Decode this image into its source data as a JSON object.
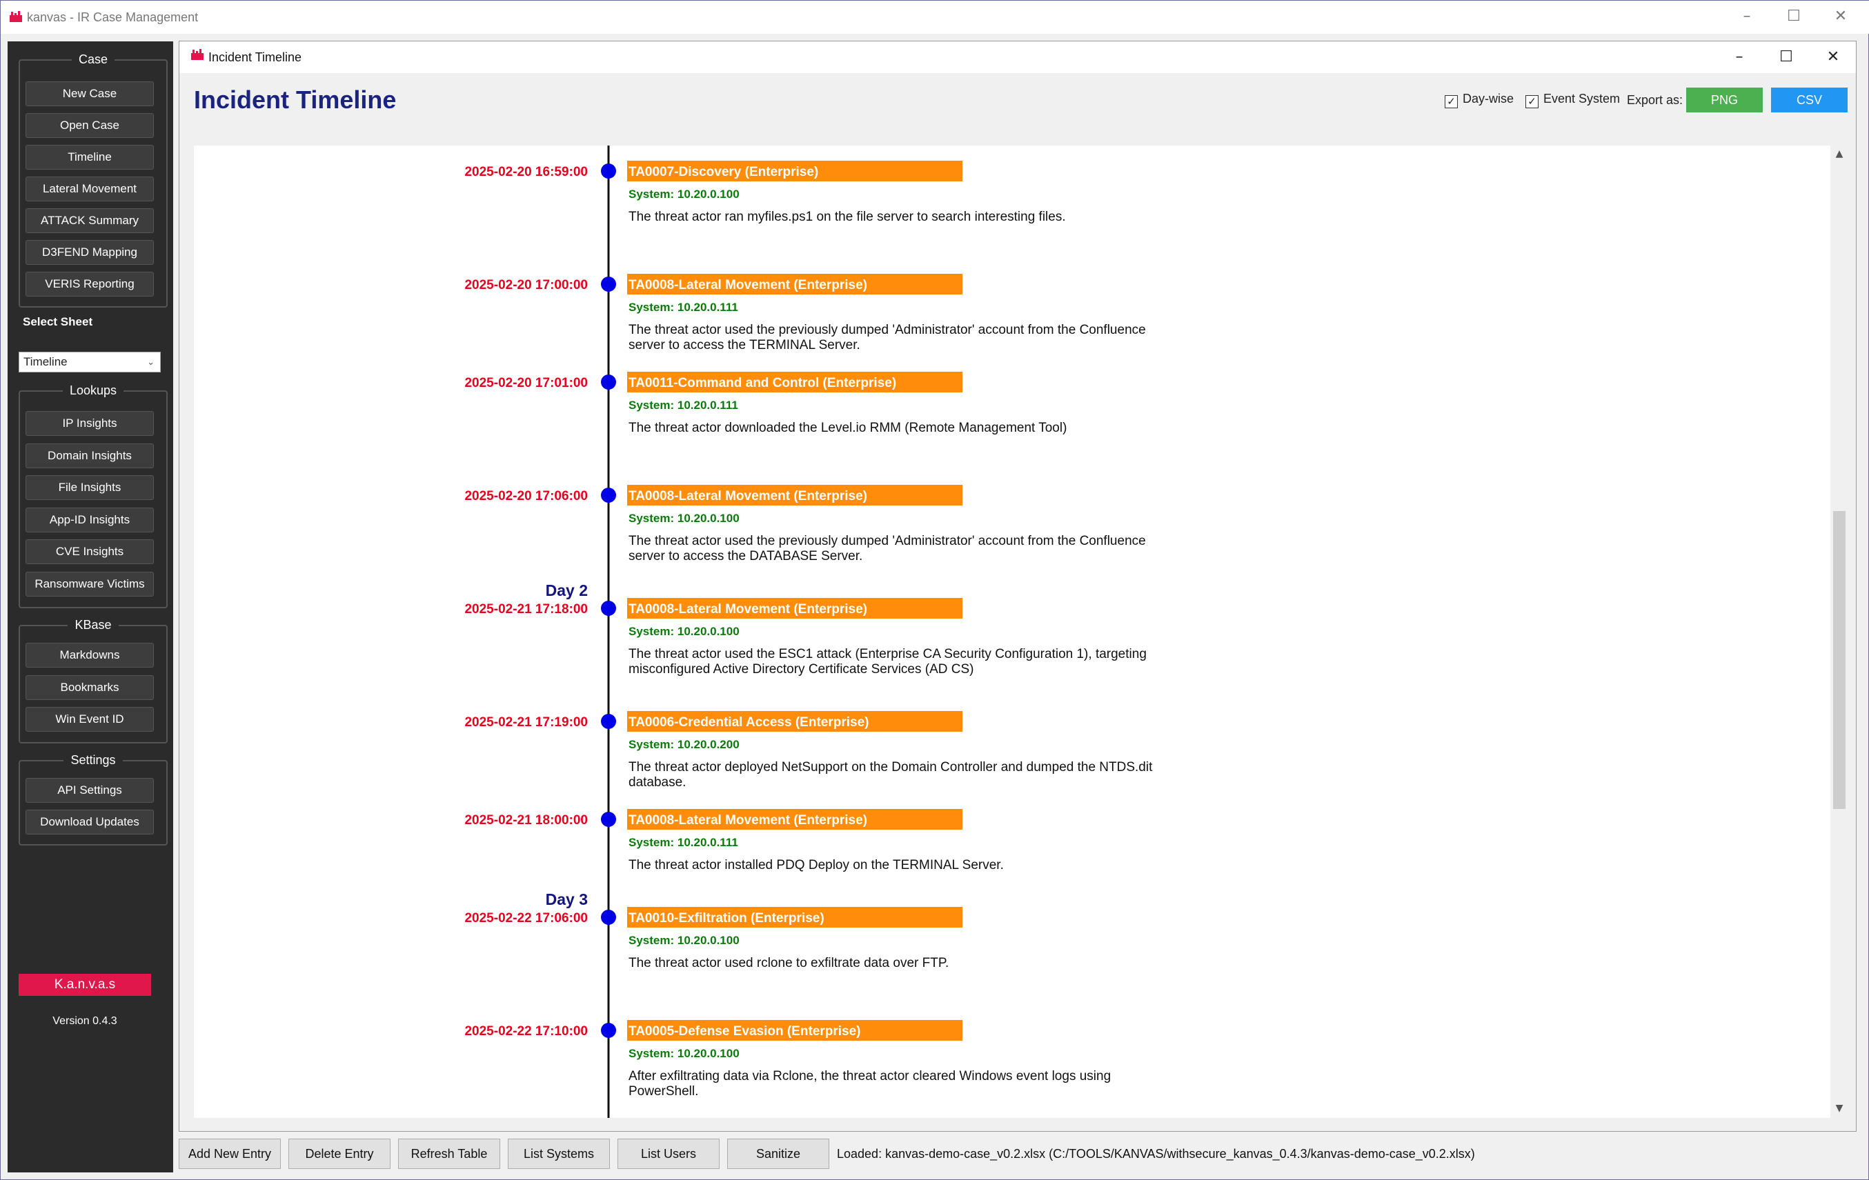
{
  "app_title": "kanvas - IR Case Management",
  "sidebar": {
    "groups": [
      {
        "title": "Case",
        "buttons": [
          "New Case",
          "Open Case",
          "Timeline",
          "Lateral Movement",
          "ATTACK Summary",
          "D3FEND Mapping",
          "VERIS Reporting"
        ]
      },
      {
        "title": "Lookups",
        "buttons": [
          "IP Insights",
          "Domain Insights",
          "File Insights",
          "App-ID Insights",
          "CVE Insights",
          "Ransomware Victims"
        ]
      },
      {
        "title": "KBase",
        "buttons": [
          "Markdowns",
          "Bookmarks",
          "Win Event ID"
        ]
      },
      {
        "title": "Settings",
        "buttons": [
          "API Settings",
          "Download Updates"
        ]
      }
    ],
    "select_sheet_label": "Select Sheet",
    "sheet_value": "Timeline",
    "brand": "K.a.n.v.a.s",
    "version": "Version 0.4.3"
  },
  "window": {
    "title": "Incident Timeline",
    "heading": "Incident Timeline",
    "options": {
      "daywise_label": "Day-wise",
      "daywise_checked": true,
      "event_system_label": "Event System",
      "event_system_checked": true
    },
    "export_label": "Export as:",
    "export_png": "PNG",
    "export_csv": "CSV"
  },
  "timeline": {
    "system_prefix": "System: ",
    "events": [
      {
        "time": "2025-02-20 16:59:00",
        "tactic": "TA0007-Discovery (Enterprise)",
        "system": "10.20.0.100",
        "desc": [
          "The threat actor ran myfiles.ps1 on the file server to search interesting files."
        ]
      },
      {
        "time": "2025-02-20 17:00:00",
        "tactic": "TA0008-Lateral Movement (Enterprise)",
        "system": "10.20.0.111",
        "desc": [
          "The threat actor used the previously dumped 'Administrator' account from the Confluence",
          "server to access the TERMINAL Server."
        ]
      },
      {
        "time": "2025-02-20 17:01:00",
        "tactic": "TA0011-Command and Control (Enterprise)",
        "system": "10.20.0.111",
        "desc": [
          "The threat actor downloaded the Level.io RMM (Remote Management Tool)"
        ]
      },
      {
        "time": "2025-02-20 17:06:00",
        "tactic": "TA0008-Lateral Movement (Enterprise)",
        "system": "10.20.0.100",
        "desc": [
          "The threat actor used the previously dumped 'Administrator' account from the Confluence",
          "server to access the DATABASE Server."
        ]
      },
      {
        "day": "Day 2",
        "time": "2025-02-21 17:18:00",
        "tactic": "TA0008-Lateral Movement (Enterprise)",
        "system": "10.20.0.100",
        "desc": [
          "The threat actor used the ESC1 attack (Enterprise CA Security Configuration 1), targeting",
          "misconfigured Active Directory Certificate Services (AD CS)"
        ]
      },
      {
        "time": "2025-02-21 17:19:00",
        "tactic": "TA0006-Credential Access (Enterprise)",
        "system": "10.20.0.200",
        "desc": [
          "The threat actor deployed NetSupport on the Domain Controller and dumped the NTDS.dit",
          "database."
        ]
      },
      {
        "time": "2025-02-21 18:00:00",
        "tactic": "TA0008-Lateral Movement (Enterprise)",
        "system": "10.20.0.111",
        "desc": [
          "The threat actor installed PDQ Deploy on the TERMINAL Server."
        ]
      },
      {
        "day": "Day 3",
        "time": "2025-02-22 17:06:00",
        "tactic": "TA0010-Exfiltration (Enterprise)",
        "system": "10.20.0.100",
        "desc": [
          "The threat actor used rclone to exfiltrate data over FTP."
        ]
      },
      {
        "time": "2025-02-22 17:10:00",
        "tactic": "TA0005-Defense Evasion (Enterprise)",
        "system": "10.20.0.100",
        "desc": [
          "After exfiltrating data via Rclone, the threat actor cleared Windows event logs using",
          "PowerShell."
        ]
      }
    ]
  },
  "bottom_buttons": [
    "Add New Entry",
    "Delete Entry",
    "Refresh Table",
    "List Systems",
    "List Users",
    "Sanitize"
  ],
  "status": "Loaded: kanvas-demo-case_v0.2.xlsx (C:/TOOLS/KANVAS/withsecure_kanvas_0.4.3/kanvas-demo-case_v0.2.xlsx)",
  "colors": {
    "time": "#e6001e",
    "day": "#14147a",
    "tactic_bg": "#ff8c0a",
    "system": "#0a7a0a",
    "dot": "#0000e6",
    "axis": "#111111",
    "png": "#4caf50",
    "csv": "#2196f3",
    "brand": "#e0174a"
  }
}
